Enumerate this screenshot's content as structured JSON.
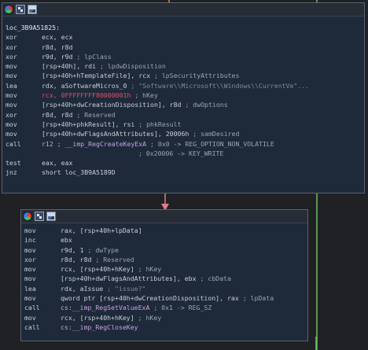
{
  "block1": {
    "label": "loc_3B9A51825:",
    "lines": [
      {
        "mn": "xor",
        "op": "ecx, ecx",
        "cm": ""
      },
      {
        "mn": "xor",
        "op": "r8d, r8d",
        "cm": ""
      },
      {
        "mn": "xor",
        "op": "r9d, r9d",
        "cm": "; lpClass"
      },
      {
        "mn": "mov",
        "op": "[rsp+40h], rdi",
        "cm": "; lpdwDisposition"
      },
      {
        "mn": "mov",
        "op": "[rsp+40h+hTemplateFile], rcx",
        "cm": "; lpSecurityAttributes"
      },
      {
        "mn": "lea",
        "op": "rdx, aSoftwareMicros_0",
        "cm": "; \"Software\\\\Microsoft\\\\Windows\\\\CurrentVe\"..."
      },
      {
        "mn": "mov",
        "op": "rcx, 0FFFFFFFF80000001h",
        "cm": "; hKey"
      },
      {
        "mn": "mov",
        "op": "[rsp+40h+dwCreationDisposition], r8d",
        "cm": "; dwOptions"
      },
      {
        "mn": "xor",
        "op": "r8d, r8d",
        "cm": "; Reserved"
      },
      {
        "mn": "mov",
        "op": "[rsp+40h+phkResult], rsi",
        "cm": "; phkResult"
      },
      {
        "mn": "mov",
        "op": "[rsp+40h+dwFlagsAndAttributes], 20006h",
        "cm": "; samDesired"
      },
      {
        "mn": "call",
        "op": "r12 ; __imp_RegCreateKeyExA",
        "cm": "; 0x0 -> REG_OPTION_NON_VOLATILE"
      },
      {
        "mn": "",
        "op": "",
        "cm": "; 0x20006 -> KEY_WRITE"
      },
      {
        "mn": "test",
        "op": "eax, eax",
        "cm": ""
      },
      {
        "mn": "jnz",
        "op": "short loc_3B9A5189D",
        "cm": ""
      }
    ]
  },
  "block2": {
    "lines": [
      {
        "mn": "mov",
        "op": "rax, [rsp+40h+lpData]",
        "cm": ""
      },
      {
        "mn": "inc",
        "op": "ebx",
        "cm": ""
      },
      {
        "mn": "mov",
        "op": "r9d, 1",
        "cm": "; dwType"
      },
      {
        "mn": "xor",
        "op": "r8d, r8d",
        "cm": "; Reserved"
      },
      {
        "mn": "mov",
        "op": "rcx, [rsp+40h+hKey]",
        "cm": "; hKey"
      },
      {
        "mn": "mov",
        "op": "[rsp+40h+dwFlagsAndAttributes], ebx",
        "cm": "; cbData"
      },
      {
        "mn": "lea",
        "op": "rdx, aIssue",
        "cm": "; \"issue?\""
      },
      {
        "mn": "mov",
        "op": "qword ptr [rsp+40h+dwCreationDisposition], rax",
        "cm": "; lpData"
      },
      {
        "mn": "call",
        "op": "cs:__imp_RegSetValueExA",
        "cm": "; 0x1 -> REG_SZ"
      },
      {
        "mn": "mov",
        "op": "rcx, [rsp+40h+hKey]",
        "cm": "; hKey"
      },
      {
        "mn": "call",
        "op": "cs:__imp_RegCloseKey",
        "cm": ""
      }
    ]
  },
  "colors": {
    "background": "#1f2125",
    "node": "#1e2a3a",
    "edge_green": "#6fbf60",
    "edge_orange": "#e08a2a",
    "edge_pink": "#e07a8a"
  },
  "icons": [
    "color-node-icon",
    "graph-view-icon",
    "picture-icon"
  ]
}
